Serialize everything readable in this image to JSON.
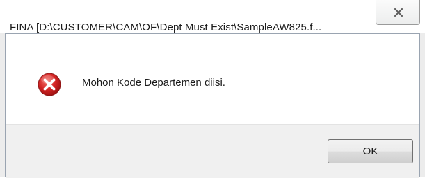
{
  "window": {
    "title": "FINA  [D:\\CUSTOMER\\CAM\\OF\\Dept Must Exist\\SampleAW825.f..."
  },
  "dialog": {
    "icon": "error-icon",
    "message": "Mohon Kode Departemen diisi.",
    "ok_label": "OK"
  },
  "colors": {
    "error_red": "#d42525",
    "button_bar": "#f0f0f0"
  }
}
